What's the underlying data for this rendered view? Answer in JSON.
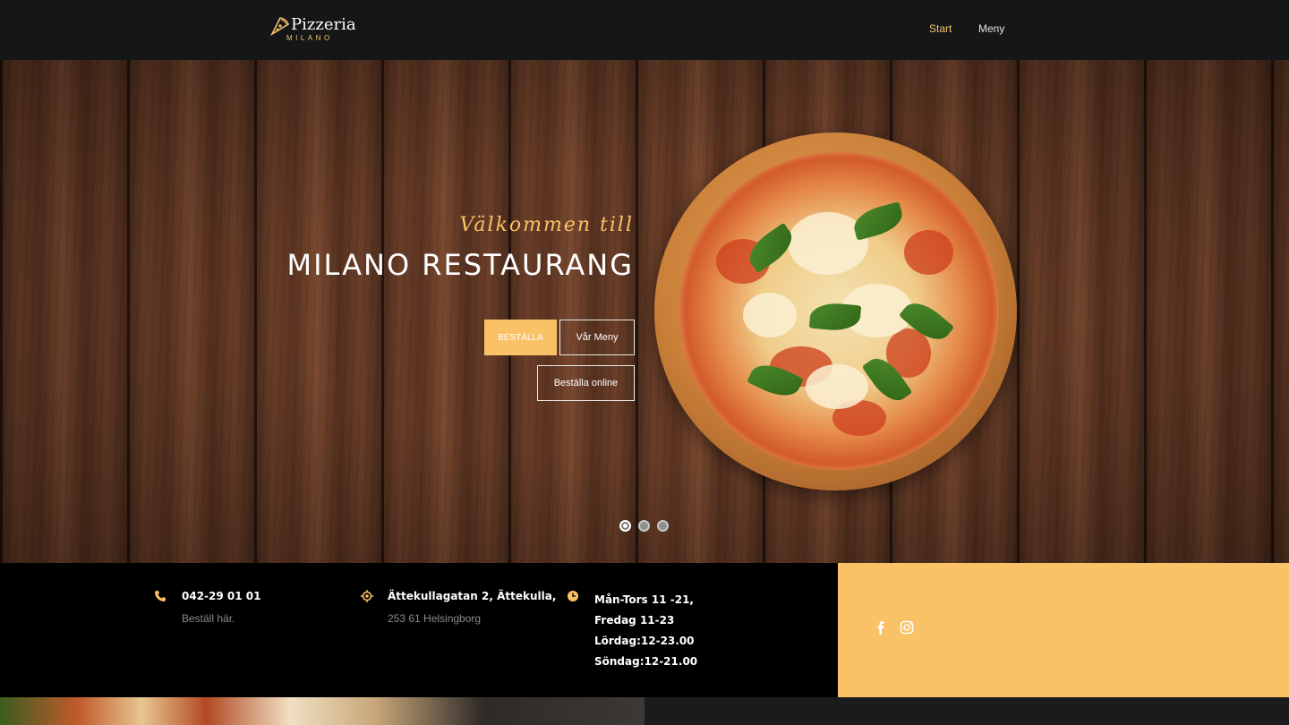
{
  "nav": {
    "logo_name": "Pizzeria",
    "logo_sub": "MILANO",
    "links": [
      {
        "label": "Start",
        "active": true
      },
      {
        "label": "Meny",
        "active": false
      }
    ]
  },
  "hero": {
    "welcome": "Välkommen till",
    "title": "MILANO RESTAURANG",
    "buttons": {
      "order": "BESTÄLLA",
      "menu": "Vår Meny",
      "online": "Beställa online"
    },
    "slides": {
      "count": 3,
      "active": 1
    }
  },
  "info": {
    "phone": {
      "main": "042-29 01 01",
      "sub": "Beställ här."
    },
    "address": {
      "main": "Ättekullagatan 2, Ättekulla,",
      "sub": "253 61 Helsingborg"
    },
    "hours": [
      "Mån-Tors 11 -21,",
      "Fredag 11-23",
      "Lördag:12-23.00",
      "Söndag:12-21.00"
    ]
  },
  "social": [
    "facebook-icon",
    "instagram-icon"
  ],
  "colors": {
    "accent": "#f9c266",
    "nav_bg": "#141618",
    "info_bg": "#000000"
  }
}
